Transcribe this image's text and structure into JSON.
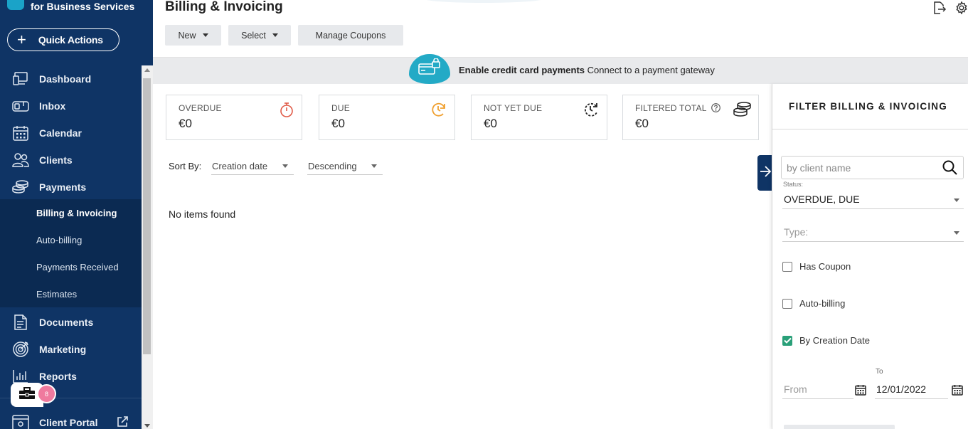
{
  "brand": {
    "subtitle": "for Business Services"
  },
  "sidebar": {
    "quick_actions": "Quick Actions",
    "items": [
      {
        "label": "Dashboard",
        "icon": "dashboard-icon"
      },
      {
        "label": "Inbox",
        "icon": "inbox-icon"
      },
      {
        "label": "Calendar",
        "icon": "calendar-icon"
      },
      {
        "label": "Clients",
        "icon": "clients-icon"
      },
      {
        "label": "Payments",
        "icon": "payments-icon"
      },
      {
        "label": "Documents",
        "icon": "document-icon"
      },
      {
        "label": "Marketing",
        "icon": "target-icon"
      },
      {
        "label": "Reports",
        "icon": "bar-chart-icon"
      },
      {
        "label": "Client Portal",
        "icon": "portal-icon"
      }
    ],
    "payments_sub": [
      {
        "label": "Billing & Invoicing",
        "active": true
      },
      {
        "label": "Auto-billing"
      },
      {
        "label": "Payments Received"
      },
      {
        "label": "Estimates"
      }
    ],
    "toolbox_badge": "8"
  },
  "header": {
    "title": "Billing & Invoicing",
    "toolbar": {
      "new_label": "New",
      "select_label": "Select",
      "coupons_label": "Manage Coupons"
    }
  },
  "banner": {
    "bold_text": "Enable credit card payments",
    "text": "Connect to a payment gateway"
  },
  "summary_cards": [
    {
      "label": "OVERDUE",
      "value": "€0",
      "icon": "stopwatch-icon",
      "color": "#e05a47"
    },
    {
      "label": "DUE",
      "value": "€0",
      "icon": "clock-refresh-icon",
      "color": "#f0a030"
    },
    {
      "label": "NOT YET DUE",
      "value": "€0",
      "icon": "clock-dashed-icon",
      "color": "#222222"
    },
    {
      "label": "FILTERED TOTAL",
      "value": "€0",
      "icon": "coins-icon",
      "color": "#222222"
    }
  ],
  "sort": {
    "label": "Sort By:",
    "field": "Creation date",
    "order": "Descending"
  },
  "list": {
    "empty_text": "No items found"
  },
  "filter": {
    "title": "FILTER BILLING & INVOICING",
    "search_placeholder": "by client name",
    "status_caption": "Status:",
    "status_value": "OVERDUE, DUE",
    "type_placeholder": "Type:",
    "has_coupon": {
      "label": "Has Coupon",
      "checked": false
    },
    "auto_billing": {
      "label": "Auto-billing",
      "checked": false
    },
    "by_creation_date": {
      "label": "By Creation Date",
      "checked": true
    },
    "date_from_placeholder": "From",
    "date_to_caption": "To",
    "date_to_value": "12/01/2022"
  },
  "colors": {
    "sidebar": "#0f3465",
    "accent": "#23aac6",
    "check": "#2aa079",
    "badge": "#ef7a9e"
  }
}
